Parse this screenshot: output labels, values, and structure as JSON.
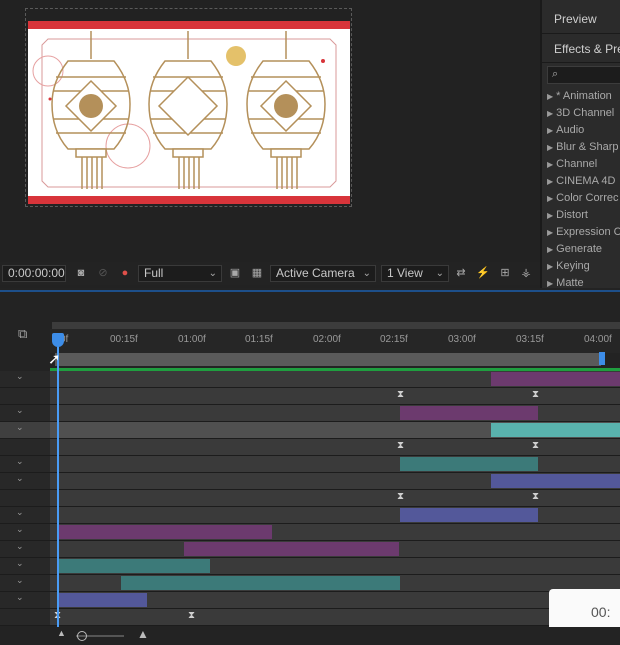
{
  "viewer": {
    "timecode": "0:00:00:00",
    "resolution": "Full",
    "camera": "Active Camera",
    "views": "1 View"
  },
  "right_panel": {
    "preview_title": "Preview",
    "effects_title": "Effects & Pre",
    "search_placeholder": "",
    "effects": [
      "* Animation",
      "3D Channel",
      "Audio",
      "Blur & Sharp",
      "Channel",
      "CINEMA 4D",
      "Color Correc",
      "Distort",
      "Expression C",
      "Generate",
      "Keying",
      "Matte"
    ]
  },
  "timeline": {
    "ruler_labels": [
      "0f",
      "00:15f",
      "01:00f",
      "01:15f",
      "02:00f",
      "02:15f",
      "03:00f",
      "03:15f",
      "04:00f"
    ],
    "tooltip_text": "00:"
  },
  "colors": {
    "purple": "#6c3a6e",
    "teal": "#3c7a79",
    "slate": "#53589a",
    "teal_selected": "#59b2ad",
    "gold": "#b4905a",
    "red": "#d8343a"
  }
}
